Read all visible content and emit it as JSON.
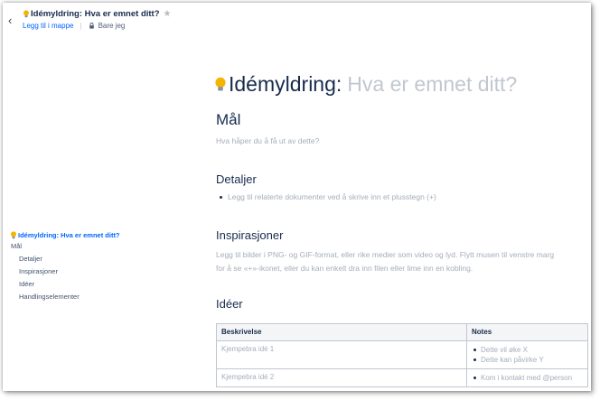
{
  "header": {
    "back_icon": "chevron-left-icon",
    "title": "Idémyldring: Hva er emnet ditt?",
    "star_icon": "star-icon",
    "folder_link": "Legg til i mappe",
    "visibility": "Bare jeg"
  },
  "toc": {
    "title": "Idémyldring: Hva er emnet ditt?",
    "items": [
      {
        "label": "Mål",
        "level": 1
      },
      {
        "label": "Detaljer",
        "level": 2
      },
      {
        "label": "Inspirasjoner",
        "level": 2
      },
      {
        "label": "Idéer",
        "level": 2
      },
      {
        "label": "Handlingselementer",
        "level": 2
      }
    ]
  },
  "content": {
    "title_main": "Idémyldring:",
    "title_placeholder": "Hva er emnet ditt?",
    "mal_heading": "Mål",
    "mal_placeholder": "Hva håper du å få ut av dette?",
    "detaljer_heading": "Detaljer",
    "detaljer_item": "Legg til relaterte dokumenter ved å skrive inn et plusstegn (+)",
    "insp_heading": "Inspirasjoner",
    "insp_placeholder": "Legg til bilder i PNG- og GIF-format, eller rike medier som video og lyd. Flytt musen til venstre marg for å se «+»-ikonet, eller du kan enkelt dra inn filen eller lime inn en kobling.",
    "ideer_heading": "Idéer",
    "table": {
      "headers": [
        "Beskrivelse",
        "Notes"
      ],
      "rows": [
        {
          "desc": "Kjempebra idé 1",
          "notes": [
            "Dette vil øke X",
            "Dette kan påvirke Y"
          ]
        },
        {
          "desc": "Kjempebra idé 2",
          "notes": [
            "Kom i kontakt med @person"
          ]
        }
      ]
    }
  },
  "colors": {
    "link": "#0065ff",
    "text": "#172b4d",
    "placeholder": "#a5adba",
    "bulb": "#f5b400"
  }
}
